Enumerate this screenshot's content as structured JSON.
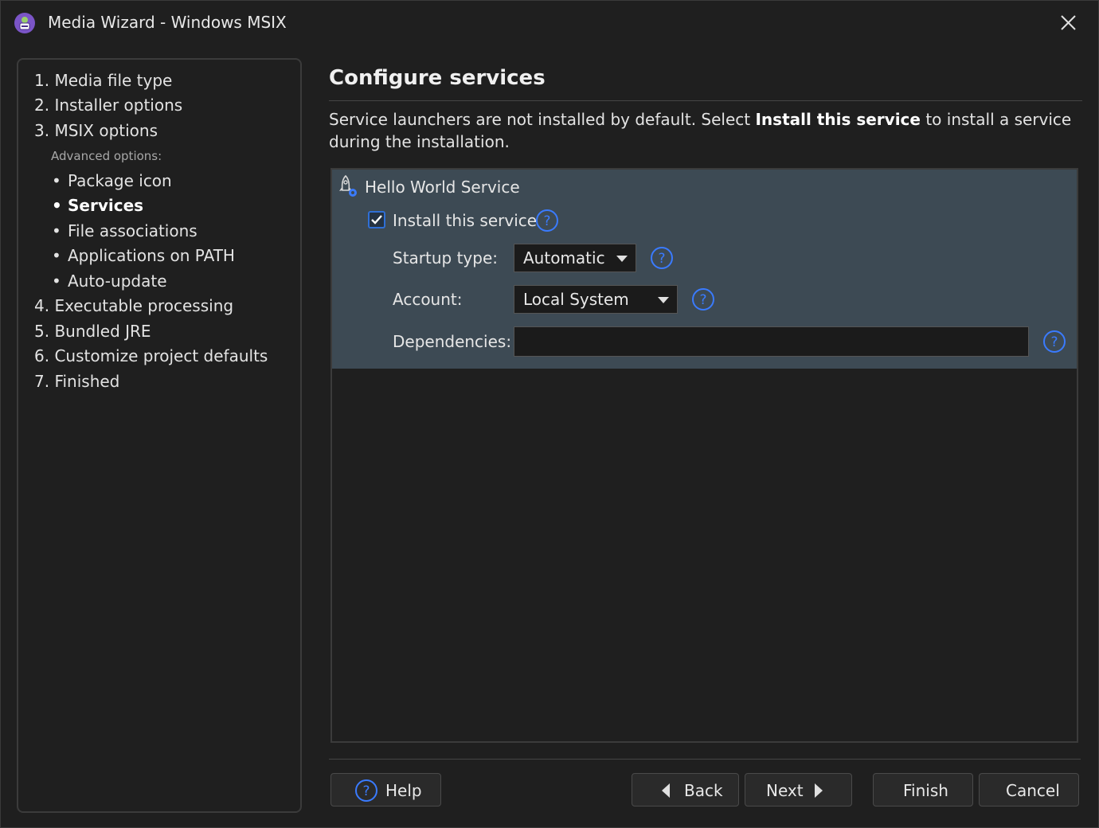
{
  "window": {
    "title": "Media Wizard - Windows MSIX",
    "app_icon": "installer-app-icon",
    "close_icon": "close-icon"
  },
  "sidebar": {
    "steps": [
      {
        "label": "1. Media file type"
      },
      {
        "label": "2. Installer options"
      },
      {
        "label": "3. MSIX options"
      }
    ],
    "advanced_heading": "Advanced options:",
    "advanced_items": [
      {
        "label": "Package icon",
        "active": false
      },
      {
        "label": "Services",
        "active": true
      },
      {
        "label": "File associations",
        "active": false
      },
      {
        "label": "Applications on PATH",
        "active": false
      },
      {
        "label": "Auto-update",
        "active": false
      }
    ],
    "later_steps": [
      {
        "label": "4. Executable processing"
      },
      {
        "label": "5. Bundled JRE"
      },
      {
        "label": "6. Customize project defaults"
      },
      {
        "label": "7. Finished"
      }
    ]
  },
  "main": {
    "heading": "Configure services",
    "description_pre": "Service launchers are not installed by default. Select ",
    "description_bold": "Install this service",
    "description_post": " to install a service during the installation."
  },
  "service": {
    "name": "Hello World Service",
    "install_label": "Install this service",
    "install_checked": true,
    "startup_label": "Startup type:",
    "startup_value": "Automatic",
    "account_label": "Account:",
    "account_value": "Local System",
    "dependencies_label": "Dependencies:",
    "dependencies_value": ""
  },
  "buttons": {
    "help": "Help",
    "back": "Back",
    "next": "Next",
    "finish": "Finish",
    "cancel": "Cancel"
  },
  "colors": {
    "accent": "#3a7bff",
    "service_block": "#3d4a54",
    "background": "#1f1f1f"
  }
}
